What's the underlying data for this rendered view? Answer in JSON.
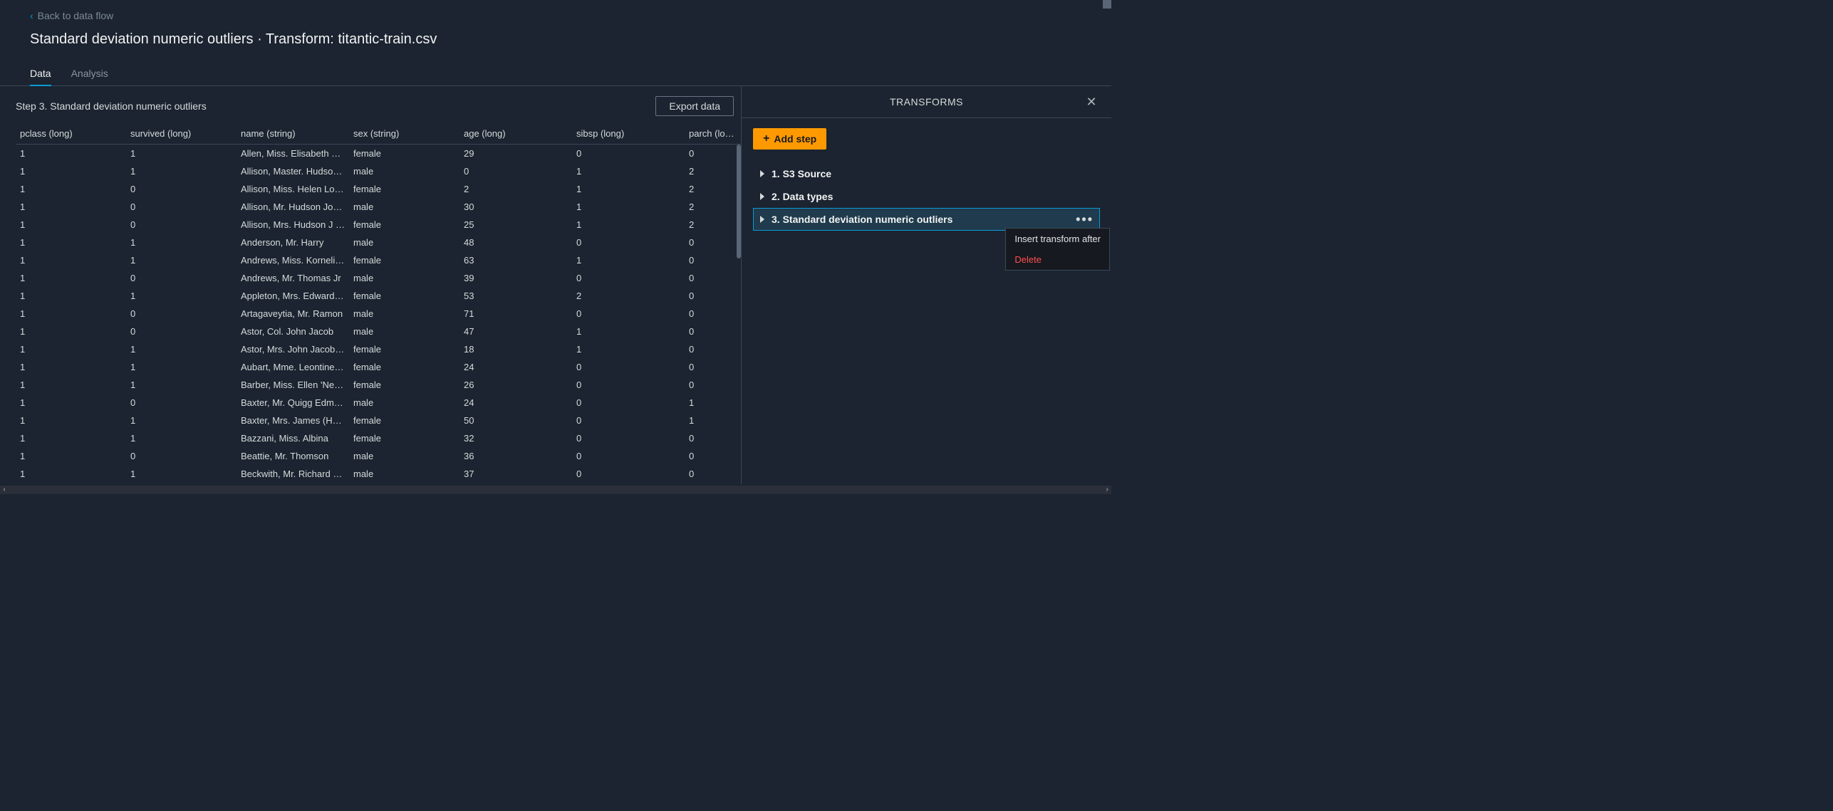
{
  "nav": {
    "back_label": "Back to data flow"
  },
  "page_title": "Standard deviation numeric outliers · Transform: titantic-train.csv",
  "tabs": {
    "data": "Data",
    "analysis": "Analysis"
  },
  "step_label": "Step 3. Standard deviation numeric outliers",
  "export_label": "Export data",
  "columns": [
    "pclass (long)",
    "survived (long)",
    "name (string)",
    "sex (string)",
    "age (long)",
    "sibsp (long)",
    "parch (long)"
  ],
  "rows": [
    [
      "1",
      "1",
      "Allen, Miss. Elisabeth W…",
      "female",
      "29",
      "0",
      "0"
    ],
    [
      "1",
      "1",
      "Allison, Master. Hudson…",
      "male",
      "0",
      "1",
      "2"
    ],
    [
      "1",
      "0",
      "Allison, Miss. Helen Lor…",
      "female",
      "2",
      "1",
      "2"
    ],
    [
      "1",
      "0",
      "Allison, Mr. Hudson Jos…",
      "male",
      "30",
      "1",
      "2"
    ],
    [
      "1",
      "0",
      "Allison, Mrs. Hudson J C…",
      "female",
      "25",
      "1",
      "2"
    ],
    [
      "1",
      "1",
      "Anderson, Mr. Harry",
      "male",
      "48",
      "0",
      "0"
    ],
    [
      "1",
      "1",
      "Andrews, Miss. Kornelia…",
      "female",
      "63",
      "1",
      "0"
    ],
    [
      "1",
      "0",
      "Andrews, Mr. Thomas Jr",
      "male",
      "39",
      "0",
      "0"
    ],
    [
      "1",
      "1",
      "Appleton, Mrs. Edward …",
      "female",
      "53",
      "2",
      "0"
    ],
    [
      "1",
      "0",
      "Artagaveytia, Mr. Ramon",
      "male",
      "71",
      "0",
      "0"
    ],
    [
      "1",
      "0",
      "Astor, Col. John Jacob",
      "male",
      "47",
      "1",
      "0"
    ],
    [
      "1",
      "1",
      "Astor, Mrs. John Jacob (…",
      "female",
      "18",
      "1",
      "0"
    ],
    [
      "1",
      "1",
      "Aubart, Mme. Leontine …",
      "female",
      "24",
      "0",
      "0"
    ],
    [
      "1",
      "1",
      "Barber, Miss. Ellen 'Nellie'",
      "female",
      "26",
      "0",
      "0"
    ],
    [
      "1",
      "0",
      "Baxter, Mr. Quigg Edmo…",
      "male",
      "24",
      "0",
      "1"
    ],
    [
      "1",
      "1",
      "Baxter, Mrs. James (Hel…",
      "female",
      "50",
      "0",
      "1"
    ],
    [
      "1",
      "1",
      "Bazzani, Miss. Albina",
      "female",
      "32",
      "0",
      "0"
    ],
    [
      "1",
      "0",
      "Beattie, Mr. Thomson",
      "male",
      "36",
      "0",
      "0"
    ],
    [
      "1",
      "1",
      "Beckwith, Mr. Richard L…",
      "male",
      "37",
      "0",
      "0"
    ]
  ],
  "side": {
    "title": "TRANSFORMS",
    "add_step": "Add step",
    "steps": [
      "1. S3 Source",
      "2. Data types",
      "3. Standard deviation numeric outliers"
    ],
    "menu": {
      "insert": "Insert transform after",
      "delete": "Delete"
    }
  }
}
